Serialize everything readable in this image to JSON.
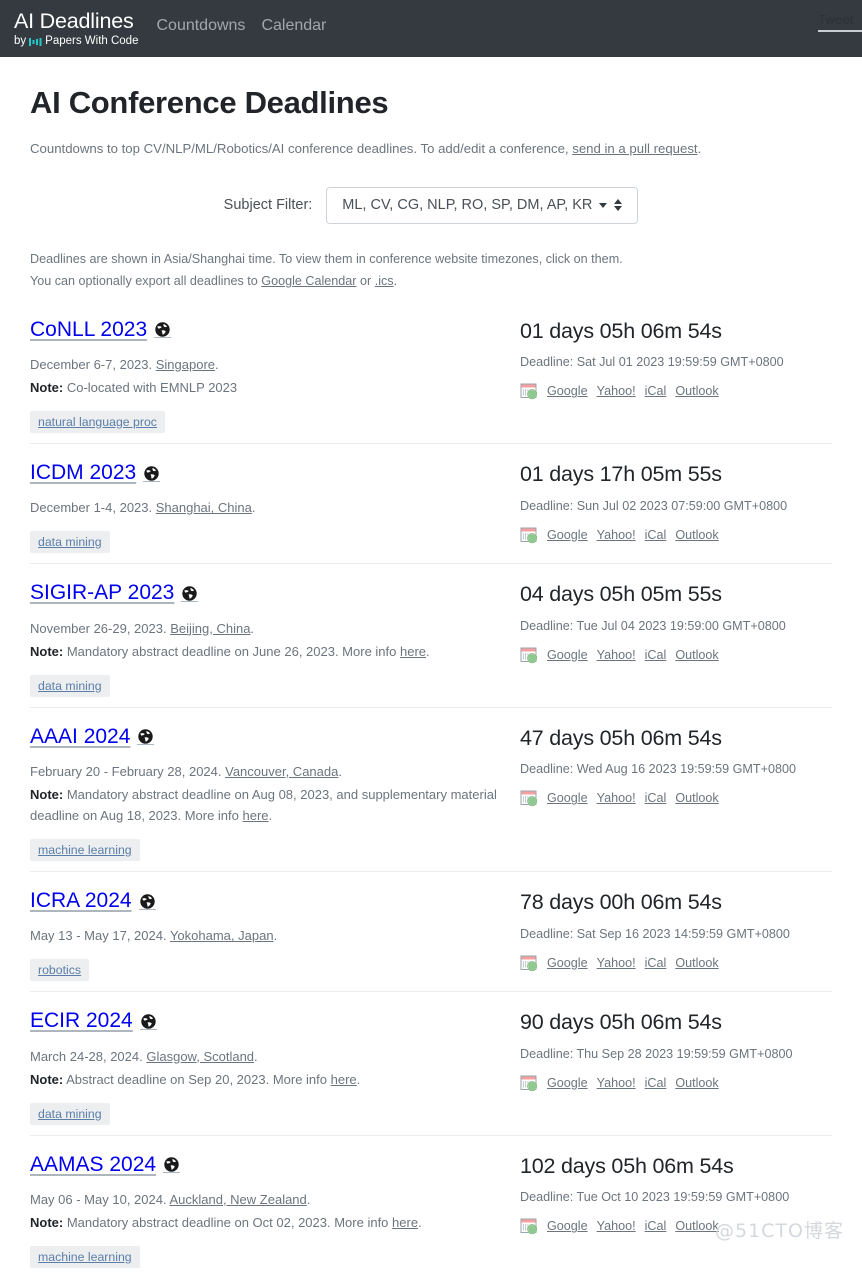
{
  "navbar": {
    "brand_title": "AI Deadlines",
    "brand_by": "by",
    "brand_org": "Papers With Code",
    "links": [
      {
        "label": "Countdowns"
      },
      {
        "label": "Calendar"
      }
    ],
    "tweet_label": "Tweet"
  },
  "page": {
    "title": "AI Conference Deadlines",
    "intro_text": "Countdowns to top CV/NLP/ML/Robotics/AI conference deadlines. To add/edit a conference, ",
    "intro_link": "send in a pull request",
    "intro_suffix": "."
  },
  "filter": {
    "label": "Subject Filter:",
    "selected": "ML, CV, CG, NLP, RO, SP, DM, AP, KR",
    "options": [
      "ML",
      "CV",
      "CG",
      "NLP",
      "RO",
      "SP",
      "DM",
      "AP",
      "KR"
    ]
  },
  "timezone_note": {
    "line1": "Deadlines are shown in Asia/Shanghai time. To view them in conference website timezones, click on them.",
    "line2_prefix": "You can optionally export all deadlines to ",
    "line2_link1": "Google Calendar",
    "line2_middle": " or ",
    "line2_link2": ".ics",
    "line2_suffix": "."
  },
  "calendar_links": {
    "google": "Google",
    "yahoo": "Yahoo!",
    "ical": "iCal",
    "outlook": "Outlook"
  },
  "conferences": [
    {
      "name": "CoNLL 2023",
      "dates": "December 6-7, 2023. ",
      "place": "Singapore",
      "place_suffix": ".",
      "note_label": "Note:",
      "note_text": " Co-located with EMNLP 2023",
      "note_link": "",
      "note_suffix": "",
      "tag": "natural language proc",
      "countdown": "01 days 05h 06m 54s",
      "deadline": "Deadline: Sat Jul 01 2023 19:59:59 GMT+0800"
    },
    {
      "name": "ICDM 2023",
      "dates": "December 1-4, 2023. ",
      "place": "Shanghai, China",
      "place_suffix": ".",
      "note_label": "",
      "note_text": "",
      "note_link": "",
      "note_suffix": "",
      "tag": "data mining",
      "countdown": "01 days 17h 05m 55s",
      "deadline": "Deadline: Sun Jul 02 2023 07:59:00 GMT+0800"
    },
    {
      "name": "SIGIR-AP 2023",
      "dates": "November 26-29, 2023. ",
      "place": "Beijing, China",
      "place_suffix": ".",
      "note_label": "Note:",
      "note_text": " Mandatory abstract deadline on June 26, 2023. More info ",
      "note_link": "here",
      "note_suffix": ".",
      "tag": "data mining",
      "countdown": "04 days 05h 05m 55s",
      "deadline": "Deadline: Tue Jul 04 2023 19:59:00 GMT+0800"
    },
    {
      "name": "AAAI 2024",
      "dates": "February 20 - February 28, 2024. ",
      "place": "Vancouver, Canada",
      "place_suffix": ".",
      "note_label": "Note:",
      "note_text": " Mandatory abstract deadline on Aug 08, 2023, and supplementary material deadline on Aug 18, 2023. More info ",
      "note_link": "here",
      "note_suffix": ".",
      "tag": "machine learning",
      "countdown": "47 days 05h 06m 54s",
      "deadline": "Deadline: Wed Aug 16 2023 19:59:59 GMT+0800"
    },
    {
      "name": "ICRA 2024",
      "dates": "May 13 - May 17, 2024. ",
      "place": "Yokohama, Japan",
      "place_suffix": ".",
      "note_label": "",
      "note_text": "",
      "note_link": "",
      "note_suffix": "",
      "tag": "robotics",
      "countdown": "78 days 00h 06m 54s",
      "deadline": "Deadline: Sat Sep 16 2023 14:59:59 GMT+0800"
    },
    {
      "name": "ECIR 2024",
      "dates": "March 24-28, 2024. ",
      "place": "Glasgow, Scotland",
      "place_suffix": ".",
      "note_label": "Note:",
      "note_text": " Abstract deadline on Sep 20, 2023. More info ",
      "note_link": "here",
      "note_suffix": ".",
      "tag": "data mining",
      "countdown": "90 days 05h 06m 54s",
      "deadline": "Deadline: Thu Sep 28 2023 19:59:59 GMT+0800"
    },
    {
      "name": "AAMAS 2024",
      "dates": "May 06 - May 10, 2024. ",
      "place": "Auckland, New Zealand",
      "place_suffix": ".",
      "note_label": "Note:",
      "note_text": " Mandatory abstract deadline on Oct 02, 2023. More info ",
      "note_link": "here",
      "note_suffix": ".",
      "tag": "machine learning",
      "countdown": "102 days 05h 06m 54s",
      "deadline": "Deadline: Tue Oct 10 2023 19:59:59 GMT+0800"
    }
  ],
  "watermark": "@51CTO博客"
}
